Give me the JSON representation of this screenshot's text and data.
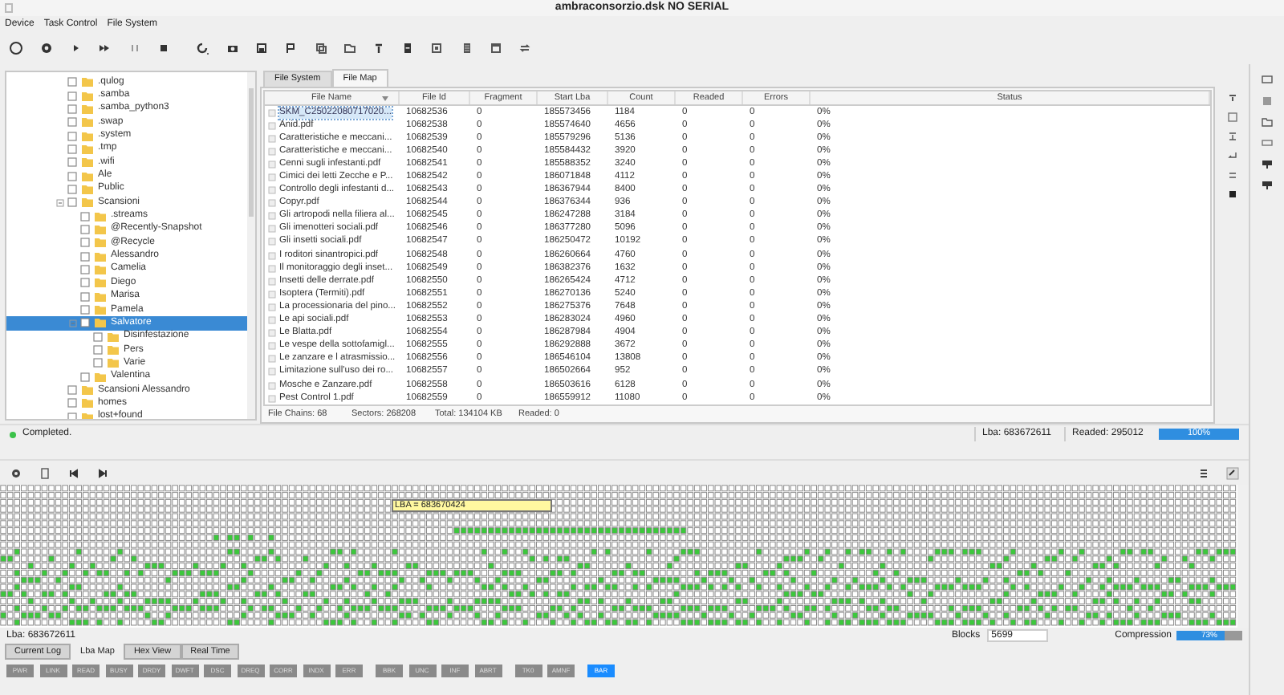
{
  "window": {
    "title": "ambraconsorzio.dsk NO SERIAL"
  },
  "menu": [
    "Device",
    "Task Control",
    "File System"
  ],
  "tree": [
    {
      "label": ".qulog",
      "checked": false,
      "selected": false
    },
    {
      "label": ".samba",
      "checked": false,
      "selected": false
    },
    {
      "label": ".samba_python3",
      "checked": false,
      "selected": false
    },
    {
      "label": ".swap",
      "checked": false,
      "selected": false
    },
    {
      "label": ".system",
      "checked": false,
      "selected": false
    },
    {
      "label": ".tmp",
      "checked": false,
      "selected": false
    },
    {
      "label": ".wifi",
      "checked": false,
      "selected": false
    },
    {
      "label": "Ale",
      "checked": false,
      "selected": false
    },
    {
      "label": "Public",
      "checked": false,
      "selected": false
    },
    {
      "label": "Scansioni",
      "checked": false,
      "selected": false,
      "expanded": true,
      "children": [
        {
          "label": ".streams",
          "checked": false,
          "selected": false
        },
        {
          "label": "@Recently-Snapshot",
          "checked": false,
          "selected": false
        },
        {
          "label": "@Recycle",
          "checked": false,
          "selected": false
        },
        {
          "label": "Alessandro",
          "checked": false,
          "selected": false
        },
        {
          "label": "Camelia",
          "checked": false,
          "selected": false
        },
        {
          "label": "Diego",
          "checked": false,
          "selected": false
        },
        {
          "label": "Marisa",
          "checked": false,
          "selected": false
        },
        {
          "label": "Pamela",
          "checked": false,
          "selected": false
        },
        {
          "label": "Salvatore",
          "checked": false,
          "selected": true,
          "expanded": true,
          "children": [
            {
              "label": "Disinfestazione",
              "checked": false,
              "selected": false
            },
            {
              "label": "Pers",
              "checked": false,
              "selected": false
            },
            {
              "label": "Varie",
              "checked": false,
              "selected": false
            }
          ]
        },
        {
          "label": "Valentina",
          "checked": false,
          "selected": false
        }
      ]
    },
    {
      "label": "Scansioni Alessandro",
      "checked": false,
      "selected": false
    },
    {
      "label": "homes",
      "checked": false,
      "selected": false
    },
    {
      "label": "lost+found",
      "checked": false,
      "selected": false
    }
  ],
  "file_tabs": [
    {
      "label": "File System",
      "selected": false
    },
    {
      "label": "File Map",
      "selected": true
    }
  ],
  "table": {
    "columns": [
      "File Name",
      "File Id",
      "Fragment",
      "Start Lba",
      "Count",
      "Readed",
      "Errors",
      "Status"
    ],
    "rows": [
      {
        "selected": true,
        "cells": [
          "SKM_C25022080717020...",
          "10682536",
          "0",
          "185573456",
          "1184",
          "0",
          "0",
          "0%"
        ]
      },
      {
        "selected": false,
        "cells": [
          "Anid.pdf",
          "10682538",
          "0",
          "185574640",
          "4656",
          "0",
          "0",
          "0%"
        ]
      },
      {
        "selected": false,
        "cells": [
          "Caratteristiche e meccani...",
          "10682539",
          "0",
          "185579296",
          "5136",
          "0",
          "0",
          "0%"
        ]
      },
      {
        "selected": false,
        "cells": [
          "Caratteristiche e meccani...",
          "10682540",
          "0",
          "185584432",
          "3920",
          "0",
          "0",
          "0%"
        ]
      },
      {
        "selected": false,
        "cells": [
          "Cenni sugli infestanti.pdf",
          "10682541",
          "0",
          "185588352",
          "3240",
          "0",
          "0",
          "0%"
        ]
      },
      {
        "selected": false,
        "cells": [
          "Cimici dei letti Zecche e P...",
          "10682542",
          "0",
          "186071848",
          "4112",
          "0",
          "0",
          "0%"
        ]
      },
      {
        "selected": false,
        "cells": [
          "Controllo degli infestanti d...",
          "10682543",
          "0",
          "186367944",
          "8400",
          "0",
          "0",
          "0%"
        ]
      },
      {
        "selected": false,
        "cells": [
          "Copyr.pdf",
          "10682544",
          "0",
          "186376344",
          "936",
          "0",
          "0",
          "0%"
        ]
      },
      {
        "selected": false,
        "cells": [
          "Gli artropodi nella filiera al...",
          "10682545",
          "0",
          "186247288",
          "3184",
          "0",
          "0",
          "0%"
        ]
      },
      {
        "selected": false,
        "cells": [
          "Gli imenotteri sociali.pdf",
          "10682546",
          "0",
          "186377280",
          "5096",
          "0",
          "0",
          "0%"
        ]
      },
      {
        "selected": false,
        "cells": [
          "Gli insetti sociali.pdf",
          "10682547",
          "0",
          "186250472",
          "10192",
          "0",
          "0",
          "0%"
        ]
      },
      {
        "selected": false,
        "cells": [
          "I roditori sinantropici.pdf",
          "10682548",
          "0",
          "186260664",
          "4760",
          "0",
          "0",
          "0%"
        ]
      },
      {
        "selected": false,
        "cells": [
          "Il monitoraggio degli inset...",
          "10682549",
          "0",
          "186382376",
          "1632",
          "0",
          "0",
          "0%"
        ]
      },
      {
        "selected": false,
        "cells": [
          "Insetti delle derrate.pdf",
          "10682550",
          "0",
          "186265424",
          "4712",
          "0",
          "0",
          "0%"
        ]
      },
      {
        "selected": false,
        "cells": [
          "Isoptera (Termiti).pdf",
          "10682551",
          "0",
          "186270136",
          "5240",
          "0",
          "0",
          "0%"
        ]
      },
      {
        "selected": false,
        "cells": [
          "La processionaria del pino...",
          "10682552",
          "0",
          "186275376",
          "7648",
          "0",
          "0",
          "0%"
        ]
      },
      {
        "selected": false,
        "cells": [
          "Le api sociali.pdf",
          "10682553",
          "0",
          "186283024",
          "4960",
          "0",
          "0",
          "0%"
        ]
      },
      {
        "selected": false,
        "cells": [
          "Le Blatta.pdf",
          "10682554",
          "0",
          "186287984",
          "4904",
          "0",
          "0",
          "0%"
        ]
      },
      {
        "selected": false,
        "cells": [
          "Le vespe della sottofamigl...",
          "10682555",
          "0",
          "186292888",
          "3672",
          "0",
          "0",
          "0%"
        ]
      },
      {
        "selected": false,
        "cells": [
          "Le zanzare e l atrasmissio...",
          "10682556",
          "0",
          "186546104",
          "13808",
          "0",
          "0",
          "0%"
        ]
      },
      {
        "selected": false,
        "cells": [
          "Limitazione sull'uso dei ro...",
          "10682557",
          "0",
          "186502664",
          "952",
          "0",
          "0",
          "0%"
        ]
      },
      {
        "selected": false,
        "cells": [
          "Mosche e Zanzare.pdf",
          "10682558",
          "0",
          "186503616",
          "6128",
          "0",
          "0",
          "0%"
        ]
      },
      {
        "selected": false,
        "cells": [
          "Pest Control 1.pdf",
          "10682559",
          "0",
          "186559912",
          "11080",
          "0",
          "0",
          "0%"
        ]
      }
    ]
  },
  "table_footer": [
    "File Chains: 68",
    "Sectors: 268208",
    "Total: 134104 KB",
    "Readed: 0"
  ],
  "status": {
    "message": "Completed.",
    "lba": "Lba: 683672611",
    "readed": "Readed: 295012",
    "progress": {
      "level": 1,
      "label": "100%"
    }
  },
  "lba_map": {
    "tooltip": "LBA = 683670424"
  },
  "map_footer": {
    "lba": "Lba: 683672611",
    "blocks_label": "Blocks",
    "blocks_value": "5699",
    "compression_label": "Compression",
    "compression": {
      "level": 0.73,
      "label": "73%"
    }
  },
  "bottom_tabs": [
    {
      "label": "Current Log",
      "selected": false
    },
    {
      "label": "Lba Map",
      "selected": true
    },
    {
      "label": "Hex View",
      "selected": false
    },
    {
      "label": "Real Time",
      "selected": false
    }
  ],
  "indicator_groups": [
    [
      {
        "label": "PWR",
        "on": false
      },
      {
        "label": "LINK",
        "on": false
      },
      {
        "label": "READ",
        "on": false
      },
      {
        "label": "BUSY",
        "on": false
      },
      {
        "label": "DRDY",
        "on": false
      },
      {
        "label": "DWFT",
        "on": false
      },
      {
        "label": "DSC",
        "on": false
      },
      {
        "label": "DREQ",
        "on": false
      },
      {
        "label": "CORR",
        "on": false
      },
      {
        "label": "INDX",
        "on": false
      },
      {
        "label": "ERR",
        "on": false
      }
    ],
    [
      {
        "label": "BBK",
        "on": false
      },
      {
        "label": "UNC",
        "on": false
      },
      {
        "label": "INF",
        "on": false
      },
      {
        "label": "ABRT",
        "on": false
      }
    ],
    [
      {
        "label": "TK0",
        "on": false
      },
      {
        "label": "AMNF",
        "on": false
      }
    ],
    [
      {
        "label": "BAR",
        "on": true
      }
    ]
  ]
}
